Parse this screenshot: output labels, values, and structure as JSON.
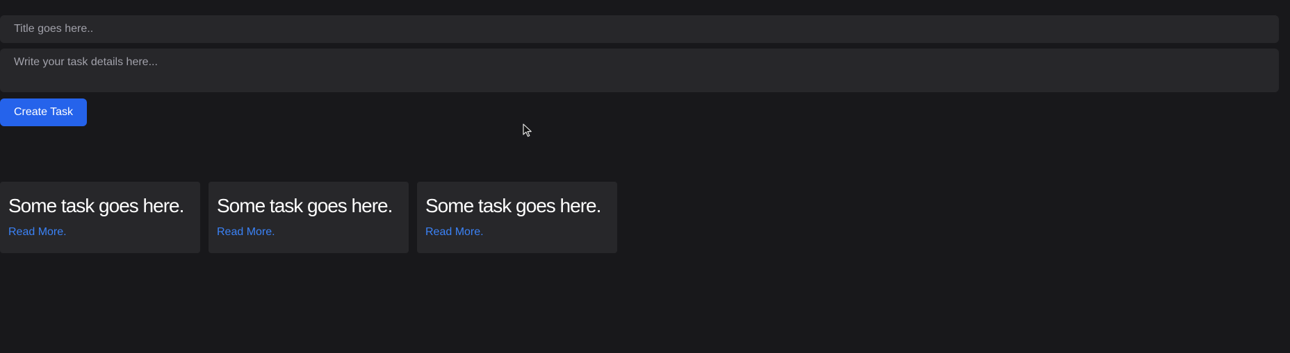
{
  "form": {
    "title_placeholder": "Title goes here..",
    "details_placeholder": "Write your task details here...",
    "create_label": "Create Task"
  },
  "tasks": [
    {
      "title": "Some task goes here.",
      "link_label": "Read More."
    },
    {
      "title": "Some task goes here.",
      "link_label": "Read More."
    },
    {
      "title": "Some task goes here.",
      "link_label": "Read More."
    }
  ],
  "colors": {
    "background": "#18181b",
    "surface": "#27272a",
    "accent": "#2563eb",
    "link": "#3b82f6"
  },
  "icons": {
    "cursor": "mouse-pointer-icon"
  }
}
